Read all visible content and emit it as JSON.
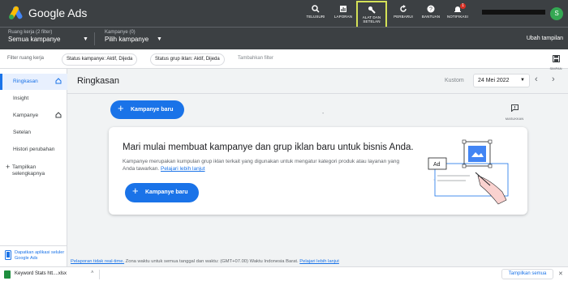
{
  "app": {
    "title": "Google Ads"
  },
  "toolbar": {
    "items": [
      {
        "label": "TELUSURI",
        "icon": "search-icon"
      },
      {
        "label": "LAPORAN",
        "icon": "reports-icon"
      },
      {
        "label": "ALAT DAN SETELAN",
        "icon": "wrench-icon"
      },
      {
        "label": "PERBARUI",
        "icon": "refresh-icon"
      },
      {
        "label": "BANTUAN",
        "icon": "help-icon"
      },
      {
        "label": "NOTIFIKASI",
        "icon": "bell-icon",
        "badge": "1"
      }
    ],
    "avatar_initial": "S"
  },
  "scope": {
    "workspace_small": "Ruang kerja (2 filter)",
    "workspace_big": "Semua kampanye",
    "campaign_small": "Kampanye (0)",
    "campaign_big": "Pilih kampanye",
    "change_view": "Ubah tampilan"
  },
  "filters": {
    "label": "Filter ruang kerja",
    "chips": [
      "Status kampanye: Aktif, Dijeda",
      "Status grup iklan: Aktif, Dijeda"
    ],
    "add": "Tambahkan filter",
    "save_label": "SIMPAN"
  },
  "sidebar": {
    "items": [
      {
        "label": "Ringkasan",
        "active": true,
        "home": true
      },
      {
        "label": "Insight",
        "active": false,
        "home": false
      },
      {
        "label": "Kampanye",
        "active": false,
        "home": true
      },
      {
        "label": "Setelan",
        "active": false,
        "home": false
      },
      {
        "label": "Histori perubahan",
        "active": false,
        "home": false
      }
    ],
    "more_label": "Tampilkan selengkapnya",
    "get_app": "Dapatkan aplikasi seluler Google Ads"
  },
  "main": {
    "title": "Ringkasan",
    "date_type": "Kustom",
    "date_value": "24 Mei 2022",
    "new_campaign": "Kampanye baru",
    "dash": "-",
    "feedback": "MASUKKAN"
  },
  "card": {
    "title": "Mari mulai membuat kampanye dan grup iklan baru untuk bisnis Anda.",
    "desc": "Kampanye merupakan kumpulan grup iklan terkait yang digunakan untuk mengatur kategori produk atau layanan yang Anda tawarkan.",
    "link": "Pelajari lebih lanjut",
    "button": "Kampanye baru",
    "ad_label": "Ad"
  },
  "footnote": {
    "link1": "Pelaporan tidak real-time.",
    "text": " Zona waktu untuk semua tanggal dan waktu: (GMT+07.00) Waktu Indonesia Barat. ",
    "link2": "Pelajari lebih lanjut"
  },
  "downloads": {
    "file": "Keyword Stats htt....xlsx",
    "show_all": "Tampilkan semua"
  },
  "colors": {
    "brand_blue": "#1a73e8",
    "header": "#3c4043",
    "highlight": "#d4e157"
  }
}
